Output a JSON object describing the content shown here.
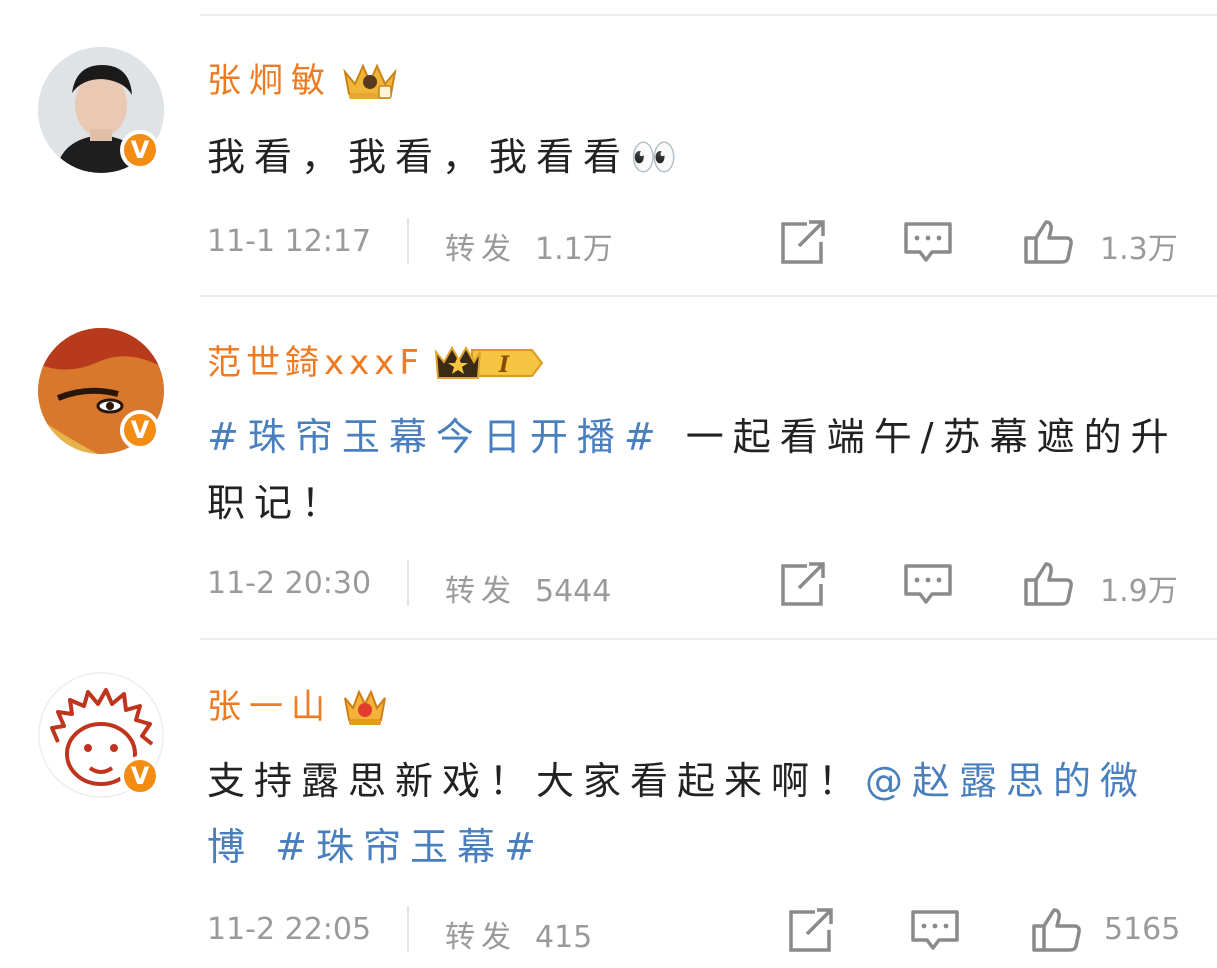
{
  "colors": {
    "username": "#ee7a22",
    "topic": "#4a7fbd",
    "meta": "#9a9a9a",
    "verified": "#f28c13"
  },
  "posts": [
    {
      "username": "张炯敏",
      "crown_icon": "gold-crown-badge-icon",
      "content": {
        "text": "我看，我看，我看看",
        "emoji": "👀"
      },
      "time": "11-1 12:17",
      "repost_label": "转发",
      "repost_count": "1.1万",
      "like_count": "1.3万"
    },
    {
      "username": "范世錡xxxF",
      "crown_icon": "crown-level-badge-icon",
      "crown_level": "I",
      "content": {
        "topic": "#珠帘玉幕今日开播#",
        "text": "一起看端午/苏幕遮的升职记！"
      },
      "time": "11-2 20:30",
      "repost_label": "转发",
      "repost_count": "5444",
      "like_count": "1.9万"
    },
    {
      "username": "张一山",
      "crown_icon": "red-gold-crown-badge-icon",
      "content": {
        "text": "支持露思新戏！大家看起来啊！",
        "mention": "@赵露思的微博",
        "topic": "#珠帘玉幕#"
      },
      "time": "11-2 22:05",
      "repost_label": "转发",
      "repost_count": "415",
      "like_count": "5165"
    }
  ]
}
